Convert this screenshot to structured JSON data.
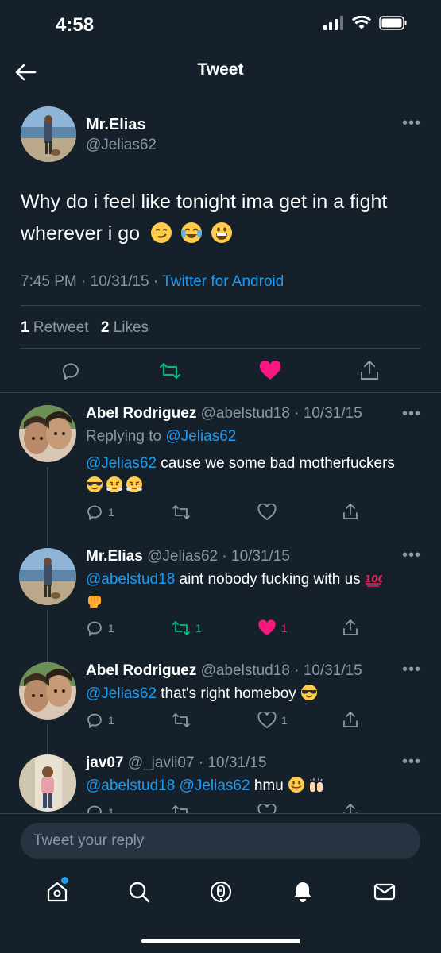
{
  "status_bar": {
    "time": "4:58"
  },
  "nav": {
    "title": "Tweet"
  },
  "main_tweet": {
    "name": "Mr.Elias",
    "handle": "@Jelias62",
    "text": "Why do i feel like tonight ima get in a fight wherever i go",
    "emojis": [
      "smirk-emoji",
      "joy-emoji",
      "grin-emoji"
    ],
    "time": "7:45 PM",
    "date": "10/31/15",
    "source": "Twitter for Android",
    "retweets_count": "1",
    "retweets_label": "Retweet",
    "likes_count": "2",
    "likes_label": "Likes"
  },
  "replies": [
    {
      "name": "Abel Rodriguez",
      "handle": "@abelstud18",
      "date": "10/31/15",
      "replying_to_label": "Replying to",
      "replying_to": "@Jelias62",
      "mention": "@Jelias62",
      "text": "cause we some bad motherfuckers",
      "reply_count": "1",
      "retweet_count": "",
      "like_count": ""
    },
    {
      "name": "Mr.Elias",
      "handle": "@Jelias62",
      "date": "10/31/15",
      "mention": "@abelstud18",
      "text": "aint nobody fucking with us",
      "reply_count": "1",
      "retweet_count": "1",
      "like_count": "1"
    },
    {
      "name": "Abel Rodriguez",
      "handle": "@abelstud18",
      "date": "10/31/15",
      "mention": "@Jelias62",
      "text": "that's right homeboy",
      "reply_count": "1",
      "retweet_count": "",
      "like_count": "1"
    },
    {
      "name": "jav07",
      "handle": "@_javii07",
      "date": "10/31/15",
      "mention": "@abelstud18 @Jelias62",
      "text": "hmu",
      "reply_count": "1"
    }
  ],
  "compose": {
    "placeholder": "Tweet your reply"
  },
  "colors": {
    "background": "#15202b",
    "accent": "#1d9bf0",
    "like": "#f91880",
    "retweet": "#00ba7c",
    "muted": "#8b98a5"
  }
}
